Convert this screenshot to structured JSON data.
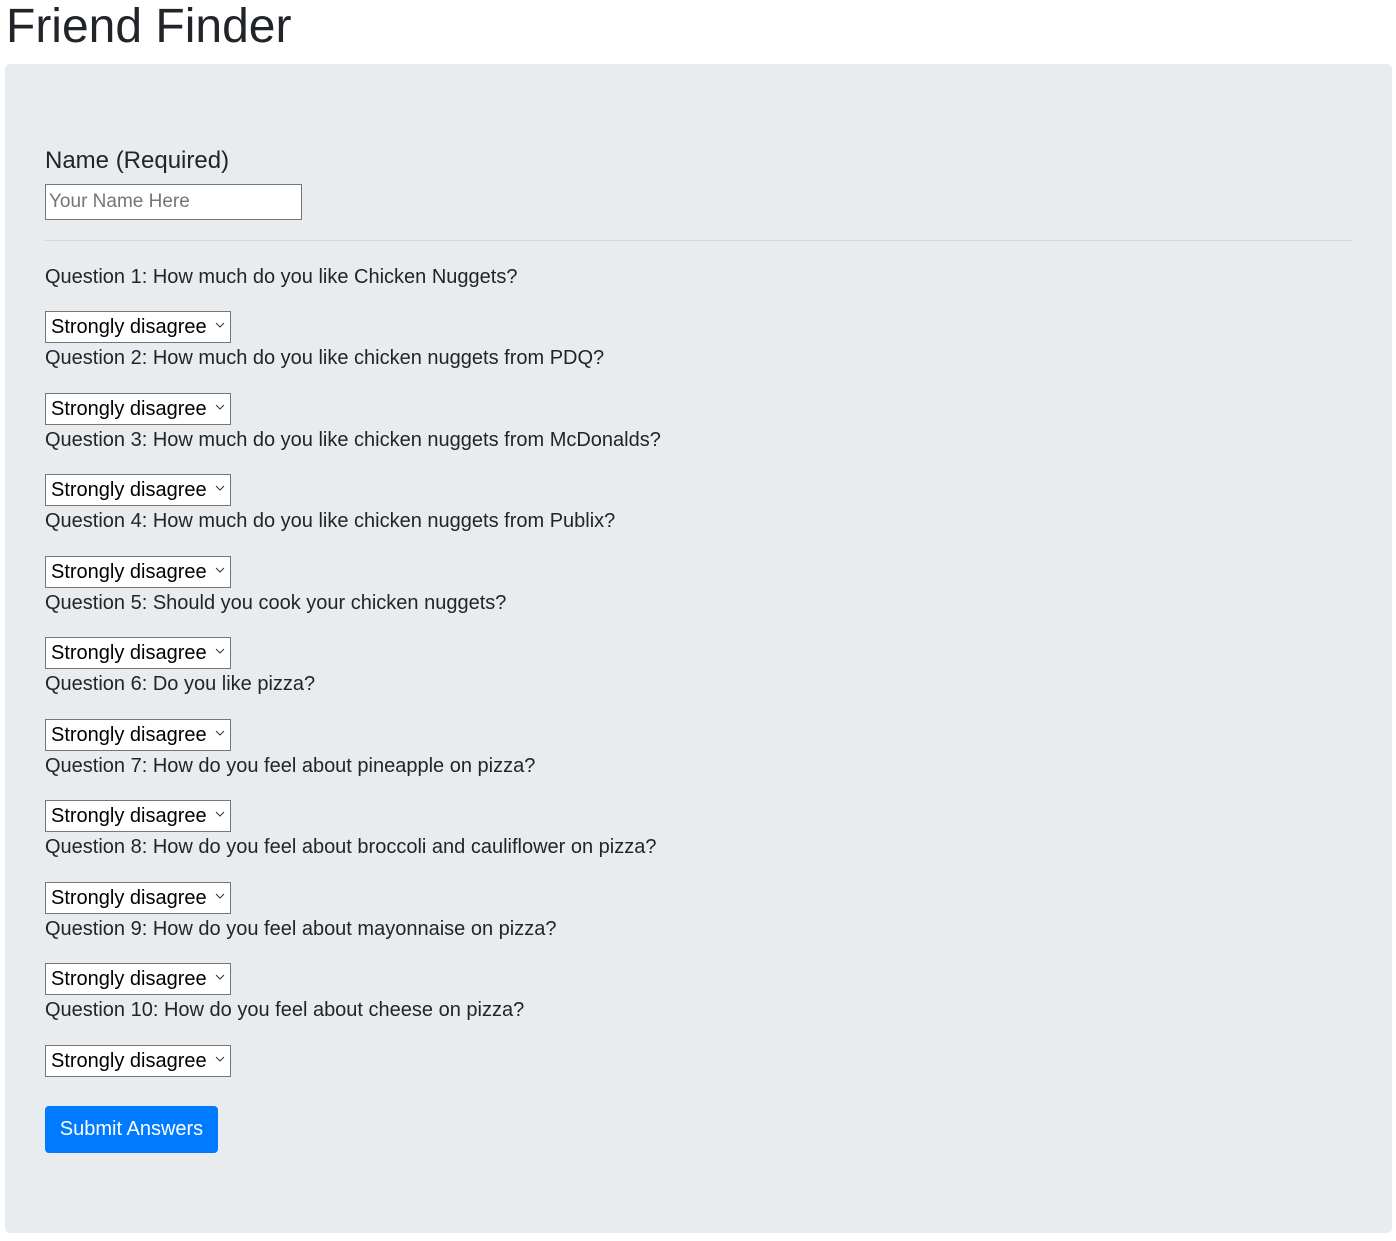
{
  "header": {
    "title": "Friend Finder"
  },
  "form": {
    "name_label": "Name (Required)",
    "name_value": "",
    "name_placeholder": "Your Name Here",
    "questions": [
      {
        "label": "Question 1: How much do you like Chicken Nuggets?",
        "selected": "Strongly disagree"
      },
      {
        "label": "Question 2: How much do you like chicken nuggets from PDQ?",
        "selected": "Strongly disagree"
      },
      {
        "label": "Question 3: How much do you like chicken nuggets from McDonalds?",
        "selected": "Strongly disagree"
      },
      {
        "label": "Question 4: How much do you like chicken nuggets from Publix?",
        "selected": "Strongly disagree"
      },
      {
        "label": "Question 5: Should you cook your chicken nuggets?",
        "selected": "Strongly disagree"
      },
      {
        "label": "Question 6: Do you like pizza?",
        "selected": "Strongly disagree"
      },
      {
        "label": "Question 7: How do you feel about pineapple on pizza?",
        "selected": "Strongly disagree"
      },
      {
        "label": "Question 8: How do you feel about broccoli and cauliflower on pizza?",
        "selected": "Strongly disagree"
      },
      {
        "label": "Question 9: How do you feel about mayonnaise on pizza?",
        "selected": "Strongly disagree"
      },
      {
        "label": "Question 10: How do you feel about cheese on pizza?",
        "selected": "Strongly disagree"
      }
    ],
    "submit_label": "Submit Answers"
  },
  "colors": {
    "panel_background": "#e9ecef",
    "primary_button": "#007bff",
    "text": "#212529"
  },
  "icons": {
    "select_arrow": "chevron-down-icon"
  }
}
